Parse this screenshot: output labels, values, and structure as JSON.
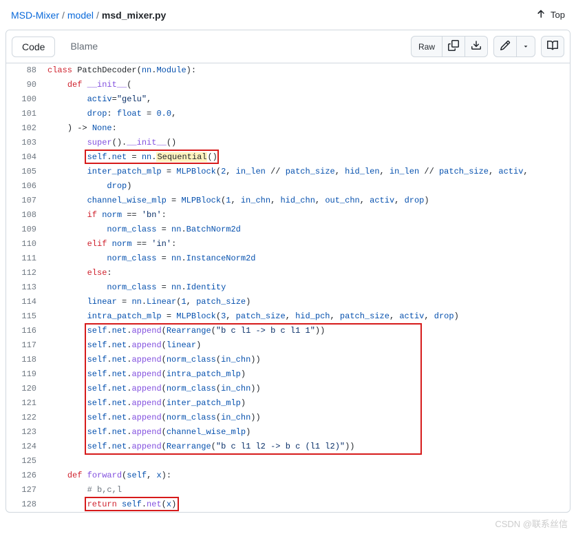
{
  "breadcrumb": {
    "repo": "MSD-Mixer",
    "folder": "model",
    "file": "msd_mixer.py",
    "topLabel": "Top"
  },
  "toolbar": {
    "codeTab": "Code",
    "blameTab": "Blame",
    "rawLabel": "Raw"
  },
  "code": {
    "lines": [
      {
        "n": "88",
        "indent": 0,
        "tokens": [
          {
            "t": "class ",
            "c": "k"
          },
          {
            "t": "PatchDecoder",
            "c": ""
          },
          {
            "t": "(",
            "c": ""
          },
          {
            "t": "nn",
            "c": "self"
          },
          {
            "t": ".",
            "c": ""
          },
          {
            "t": "Module",
            "c": "self"
          },
          {
            "t": "):",
            "c": ""
          }
        ]
      },
      {
        "n": "90",
        "indent": 1,
        "tokens": [
          {
            "t": "def ",
            "c": "k"
          },
          {
            "t": "__init__",
            "c": "fn"
          },
          {
            "t": "(",
            "c": ""
          }
        ]
      },
      {
        "n": "100",
        "indent": 2,
        "tokens": [
          {
            "t": "activ",
            "c": "self"
          },
          {
            "t": "=",
            "c": ""
          },
          {
            "t": "\"gelu\"",
            "c": "s"
          },
          {
            "t": ",",
            "c": ""
          }
        ]
      },
      {
        "n": "101",
        "indent": 2,
        "tokens": [
          {
            "t": "drop",
            "c": "self"
          },
          {
            "t": ": ",
            "c": ""
          },
          {
            "t": "float",
            "c": "self"
          },
          {
            "t": " = ",
            "c": ""
          },
          {
            "t": "0.0",
            "c": "n"
          },
          {
            "t": ",",
            "c": ""
          }
        ]
      },
      {
        "n": "102",
        "indent": 1,
        "tokens": [
          {
            "t": ") -> ",
            "c": ""
          },
          {
            "t": "None",
            "c": "n"
          },
          {
            "t": ":",
            "c": ""
          }
        ]
      },
      {
        "n": "103",
        "indent": 2,
        "tokens": [
          {
            "t": "super",
            "c": "fn"
          },
          {
            "t": "().",
            "c": ""
          },
          {
            "t": "__init__",
            "c": "fn"
          },
          {
            "t": "()",
            "c": ""
          }
        ]
      },
      {
        "n": "104",
        "indent": 2,
        "boxed": "single",
        "tokens": [
          {
            "t": "self",
            "c": "self"
          },
          {
            "t": ".",
            "c": ""
          },
          {
            "t": "net",
            "c": "self"
          },
          {
            "t": " = ",
            "c": ""
          },
          {
            "t": "nn",
            "c": "self"
          },
          {
            "t": ".",
            "c": ""
          },
          {
            "t": "Sequential",
            "c": "hl-word"
          },
          {
            "t": "()",
            "c": ""
          }
        ]
      },
      {
        "n": "105",
        "indent": 2,
        "tokens": [
          {
            "t": "inter_patch_mlp",
            "c": "self"
          },
          {
            "t": " = ",
            "c": ""
          },
          {
            "t": "MLPBlock",
            "c": "self"
          },
          {
            "t": "(",
            "c": ""
          },
          {
            "t": "2",
            "c": "n"
          },
          {
            "t": ", ",
            "c": ""
          },
          {
            "t": "in_len",
            "c": "self"
          },
          {
            "t": " // ",
            "c": ""
          },
          {
            "t": "patch_size",
            "c": "self"
          },
          {
            "t": ", ",
            "c": ""
          },
          {
            "t": "hid_len",
            "c": "self"
          },
          {
            "t": ", ",
            "c": ""
          },
          {
            "t": "in_len",
            "c": "self"
          },
          {
            "t": " // ",
            "c": ""
          },
          {
            "t": "patch_size",
            "c": "self"
          },
          {
            "t": ", ",
            "c": ""
          },
          {
            "t": "activ",
            "c": "self"
          },
          {
            "t": ",",
            "c": ""
          }
        ]
      },
      {
        "n": "106",
        "indent": 3,
        "tokens": [
          {
            "t": "drop",
            "c": "self"
          },
          {
            "t": ")",
            "c": ""
          }
        ]
      },
      {
        "n": "107",
        "indent": 2,
        "tokens": [
          {
            "t": "channel_wise_mlp",
            "c": "self"
          },
          {
            "t": " = ",
            "c": ""
          },
          {
            "t": "MLPBlock",
            "c": "self"
          },
          {
            "t": "(",
            "c": ""
          },
          {
            "t": "1",
            "c": "n"
          },
          {
            "t": ", ",
            "c": ""
          },
          {
            "t": "in_chn",
            "c": "self"
          },
          {
            "t": ", ",
            "c": ""
          },
          {
            "t": "hid_chn",
            "c": "self"
          },
          {
            "t": ", ",
            "c": ""
          },
          {
            "t": "out_chn",
            "c": "self"
          },
          {
            "t": ", ",
            "c": ""
          },
          {
            "t": "activ",
            "c": "self"
          },
          {
            "t": ", ",
            "c": ""
          },
          {
            "t": "drop",
            "c": "self"
          },
          {
            "t": ")",
            "c": ""
          }
        ]
      },
      {
        "n": "108",
        "indent": 2,
        "tokens": [
          {
            "t": "if ",
            "c": "k"
          },
          {
            "t": "norm",
            "c": "self"
          },
          {
            "t": " == ",
            "c": ""
          },
          {
            "t": "'bn'",
            "c": "s"
          },
          {
            "t": ":",
            "c": ""
          }
        ]
      },
      {
        "n": "109",
        "indent": 3,
        "tokens": [
          {
            "t": "norm_class",
            "c": "self"
          },
          {
            "t": " = ",
            "c": ""
          },
          {
            "t": "nn",
            "c": "self"
          },
          {
            "t": ".",
            "c": ""
          },
          {
            "t": "BatchNorm2d",
            "c": "self"
          }
        ]
      },
      {
        "n": "110",
        "indent": 2,
        "tokens": [
          {
            "t": "elif ",
            "c": "k"
          },
          {
            "t": "norm",
            "c": "self"
          },
          {
            "t": " == ",
            "c": ""
          },
          {
            "t": "'in'",
            "c": "s"
          },
          {
            "t": ":",
            "c": ""
          }
        ]
      },
      {
        "n": "111",
        "indent": 3,
        "tokens": [
          {
            "t": "norm_class",
            "c": "self"
          },
          {
            "t": " = ",
            "c": ""
          },
          {
            "t": "nn",
            "c": "self"
          },
          {
            "t": ".",
            "c": ""
          },
          {
            "t": "InstanceNorm2d",
            "c": "self"
          }
        ]
      },
      {
        "n": "112",
        "indent": 2,
        "tokens": [
          {
            "t": "else",
            "c": "k"
          },
          {
            "t": ":",
            "c": ""
          }
        ]
      },
      {
        "n": "113",
        "indent": 3,
        "tokens": [
          {
            "t": "norm_class",
            "c": "self"
          },
          {
            "t": " = ",
            "c": ""
          },
          {
            "t": "nn",
            "c": "self"
          },
          {
            "t": ".",
            "c": ""
          },
          {
            "t": "Identity",
            "c": "self"
          }
        ]
      },
      {
        "n": "114",
        "indent": 2,
        "tokens": [
          {
            "t": "linear",
            "c": "self"
          },
          {
            "t": " = ",
            "c": ""
          },
          {
            "t": "nn",
            "c": "self"
          },
          {
            "t": ".",
            "c": ""
          },
          {
            "t": "Linear",
            "c": "self"
          },
          {
            "t": "(",
            "c": ""
          },
          {
            "t": "1",
            "c": "n"
          },
          {
            "t": ", ",
            "c": ""
          },
          {
            "t": "patch_size",
            "c": "self"
          },
          {
            "t": ")",
            "c": ""
          }
        ]
      },
      {
        "n": "115",
        "indent": 2,
        "tokens": [
          {
            "t": "intra_patch_mlp",
            "c": "self"
          },
          {
            "t": " = ",
            "c": ""
          },
          {
            "t": "MLPBlock",
            "c": "self"
          },
          {
            "t": "(",
            "c": ""
          },
          {
            "t": "3",
            "c": "n"
          },
          {
            "t": ", ",
            "c": ""
          },
          {
            "t": "patch_size",
            "c": "self"
          },
          {
            "t": ", ",
            "c": ""
          },
          {
            "t": "hid_pch",
            "c": "self"
          },
          {
            "t": ", ",
            "c": ""
          },
          {
            "t": "patch_size",
            "c": "self"
          },
          {
            "t": ", ",
            "c": ""
          },
          {
            "t": "activ",
            "c": "self"
          },
          {
            "t": ", ",
            "c": ""
          },
          {
            "t": "drop",
            "c": "self"
          },
          {
            "t": ")",
            "c": ""
          }
        ]
      },
      {
        "n": "116",
        "indent": 2,
        "tokens": [
          {
            "t": "self",
            "c": "self"
          },
          {
            "t": ".",
            "c": ""
          },
          {
            "t": "net",
            "c": "self"
          },
          {
            "t": ".",
            "c": ""
          },
          {
            "t": "append",
            "c": "fn"
          },
          {
            "t": "(",
            "c": ""
          },
          {
            "t": "Rearrange",
            "c": "self"
          },
          {
            "t": "(",
            "c": ""
          },
          {
            "t": "\"b c l1 -> b c l1 1\"",
            "c": "s"
          },
          {
            "t": "))",
            "c": ""
          }
        ]
      },
      {
        "n": "117",
        "indent": 2,
        "tokens": [
          {
            "t": "self",
            "c": "self"
          },
          {
            "t": ".",
            "c": ""
          },
          {
            "t": "net",
            "c": "self"
          },
          {
            "t": ".",
            "c": ""
          },
          {
            "t": "append",
            "c": "fn"
          },
          {
            "t": "(",
            "c": ""
          },
          {
            "t": "linear",
            "c": "self"
          },
          {
            "t": ")",
            "c": ""
          }
        ]
      },
      {
        "n": "118",
        "indent": 2,
        "tokens": [
          {
            "t": "self",
            "c": "self"
          },
          {
            "t": ".",
            "c": ""
          },
          {
            "t": "net",
            "c": "self"
          },
          {
            "t": ".",
            "c": ""
          },
          {
            "t": "append",
            "c": "fn"
          },
          {
            "t": "(",
            "c": ""
          },
          {
            "t": "norm_class",
            "c": "self"
          },
          {
            "t": "(",
            "c": ""
          },
          {
            "t": "in_chn",
            "c": "self"
          },
          {
            "t": "))",
            "c": ""
          }
        ]
      },
      {
        "n": "119",
        "indent": 2,
        "tokens": [
          {
            "t": "self",
            "c": "self"
          },
          {
            "t": ".",
            "c": ""
          },
          {
            "t": "net",
            "c": "self"
          },
          {
            "t": ".",
            "c": ""
          },
          {
            "t": "append",
            "c": "fn"
          },
          {
            "t": "(",
            "c": ""
          },
          {
            "t": "intra_patch_mlp",
            "c": "self"
          },
          {
            "t": ")",
            "c": ""
          }
        ]
      },
      {
        "n": "120",
        "indent": 2,
        "tokens": [
          {
            "t": "self",
            "c": "self"
          },
          {
            "t": ".",
            "c": ""
          },
          {
            "t": "net",
            "c": "self"
          },
          {
            "t": ".",
            "c": ""
          },
          {
            "t": "append",
            "c": "fn"
          },
          {
            "t": "(",
            "c": ""
          },
          {
            "t": "norm_class",
            "c": "self"
          },
          {
            "t": "(",
            "c": ""
          },
          {
            "t": "in_chn",
            "c": "self"
          },
          {
            "t": "))",
            "c": ""
          }
        ]
      },
      {
        "n": "121",
        "indent": 2,
        "tokens": [
          {
            "t": "self",
            "c": "self"
          },
          {
            "t": ".",
            "c": ""
          },
          {
            "t": "net",
            "c": "self"
          },
          {
            "t": ".",
            "c": ""
          },
          {
            "t": "append",
            "c": "fn"
          },
          {
            "t": "(",
            "c": ""
          },
          {
            "t": "inter_patch_mlp",
            "c": "self"
          },
          {
            "t": ")",
            "c": ""
          }
        ]
      },
      {
        "n": "122",
        "indent": 2,
        "tokens": [
          {
            "t": "self",
            "c": "self"
          },
          {
            "t": ".",
            "c": ""
          },
          {
            "t": "net",
            "c": "self"
          },
          {
            "t": ".",
            "c": ""
          },
          {
            "t": "append",
            "c": "fn"
          },
          {
            "t": "(",
            "c": ""
          },
          {
            "t": "norm_class",
            "c": "self"
          },
          {
            "t": "(",
            "c": ""
          },
          {
            "t": "in_chn",
            "c": "self"
          },
          {
            "t": "))",
            "c": ""
          }
        ]
      },
      {
        "n": "123",
        "indent": 2,
        "tokens": [
          {
            "t": "self",
            "c": "self"
          },
          {
            "t": ".",
            "c": ""
          },
          {
            "t": "net",
            "c": "self"
          },
          {
            "t": ".",
            "c": ""
          },
          {
            "t": "append",
            "c": "fn"
          },
          {
            "t": "(",
            "c": ""
          },
          {
            "t": "channel_wise_mlp",
            "c": "self"
          },
          {
            "t": ")",
            "c": ""
          }
        ]
      },
      {
        "n": "124",
        "indent": 2,
        "tokens": [
          {
            "t": "self",
            "c": "self"
          },
          {
            "t": ".",
            "c": ""
          },
          {
            "t": "net",
            "c": "self"
          },
          {
            "t": ".",
            "c": ""
          },
          {
            "t": "append",
            "c": "fn"
          },
          {
            "t": "(",
            "c": ""
          },
          {
            "t": "Rearrange",
            "c": "self"
          },
          {
            "t": "(",
            "c": ""
          },
          {
            "t": "\"b c l1 l2 -> b c (l1 l2)\"",
            "c": "s"
          },
          {
            "t": "))",
            "c": ""
          }
        ]
      },
      {
        "n": "125",
        "indent": 0,
        "tokens": []
      },
      {
        "n": "126",
        "indent": 1,
        "tokens": [
          {
            "t": "def ",
            "c": "k"
          },
          {
            "t": "forward",
            "c": "fn"
          },
          {
            "t": "(",
            "c": ""
          },
          {
            "t": "self",
            "c": "self"
          },
          {
            "t": ", ",
            "c": ""
          },
          {
            "t": "x",
            "c": "self"
          },
          {
            "t": "):",
            "c": ""
          }
        ]
      },
      {
        "n": "127",
        "indent": 2,
        "tokens": [
          {
            "t": "# b,c,l",
            "c": "c"
          }
        ]
      },
      {
        "n": "128",
        "indent": 2,
        "boxed": "single",
        "tokens": [
          {
            "t": "return ",
            "c": "k"
          },
          {
            "t": "self",
            "c": "self"
          },
          {
            "t": ".",
            "c": ""
          },
          {
            "t": "net",
            "c": "fn"
          },
          {
            "t": "(",
            "c": ""
          },
          {
            "t": "x",
            "c": "self"
          },
          {
            "t": ")",
            "c": ""
          }
        ]
      }
    ]
  },
  "watermark": "CSDN @联系丝信"
}
